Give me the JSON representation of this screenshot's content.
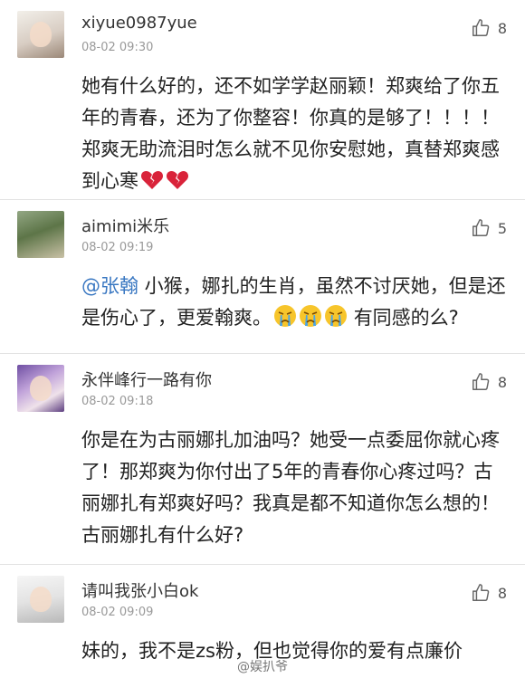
{
  "comments": [
    {
      "username": "xiyue0987yue",
      "time": "08-02 09:30",
      "likes": "8",
      "avatar": "girl-portrait-avatar",
      "text": "她有什么好的，还不如学学赵丽颖！郑爽给了你五年的青春，还为了你整容！你真的是够了！！！！郑爽无助流泪时怎么就不见你安慰她，真替郑爽感到心寒",
      "emoji": "broken-heart-icon"
    },
    {
      "username": "aimimi米乐",
      "time": "08-02 09:19",
      "likes": "5",
      "avatar": "outdoor-photo-avatar",
      "mention": "@张翰",
      "text": " 小猴，娜扎的生肖，虽然不讨厌她，但是还是伤心了，更爱翰爽。",
      "text_after": "有同感的么?",
      "emoji": "crying-face-icon"
    },
    {
      "username": "永伴峰行一路有你",
      "time": "08-02 09:18",
      "likes": "8",
      "avatar": "purple-hair-avatar",
      "text": "你是在为古丽娜扎加油吗？她受一点委屈你就心疼了！那郑爽为你付出了5年的青春你心疼过吗？古丽娜扎有郑爽好吗？我真是都不知道你怎么想的！古丽娜扎有什么好?"
    },
    {
      "username": "请叫我张小白ok",
      "time": "08-02 09:09",
      "likes": "8",
      "avatar": "light-portrait-avatar",
      "text": "妹的，我不是zs粉，但也觉得你的爱有点廉价"
    }
  ],
  "watermark": "@娱扒爷",
  "colors": {
    "mention": "#3a78c2",
    "divider": "#e2e2e2",
    "time": "#999999"
  }
}
